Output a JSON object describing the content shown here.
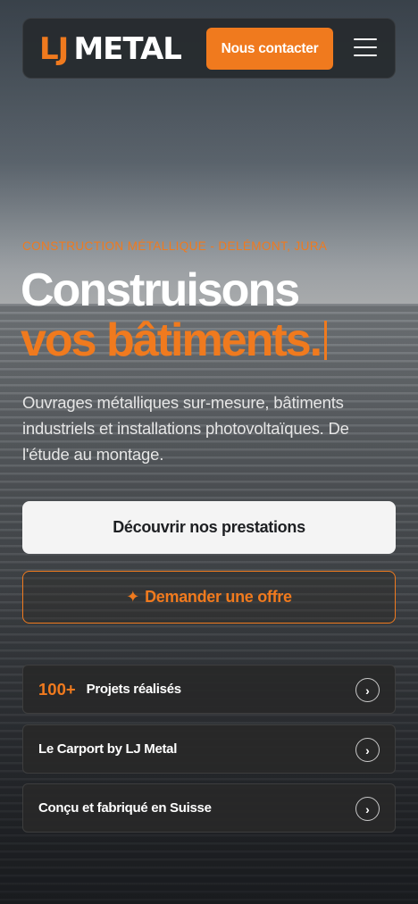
{
  "header": {
    "logo_lj": "LJ",
    "logo_metal": "METAL",
    "contact_label": "Nous contacter",
    "accent_color": "#f07a1e"
  },
  "hero": {
    "eyebrow": "CONSTRUCTION MÉTALLIQUE - DELÉMONT, JURA",
    "title_line1": "Construisons",
    "title_line2": "vos bâtiments.",
    "subtitle": "Ouvrages métalliques sur-mesure, bâtiments industriels et installations photovoltaïques. De l'étude au montage.",
    "primary_cta": "Découvrir nos prestations",
    "secondary_cta_icon": "✦",
    "secondary_cta": "Demander une offre"
  },
  "cards": [
    {
      "stat": "100+",
      "label": "Projets réalisés",
      "icon": "chevron-right-icon"
    },
    {
      "stat": "",
      "label": "Le Carport by LJ Metal",
      "icon": "chevron-right-icon"
    },
    {
      "stat": "",
      "label": "Conçu et fabriqué en Suisse",
      "icon": "chevron-right-icon"
    }
  ]
}
